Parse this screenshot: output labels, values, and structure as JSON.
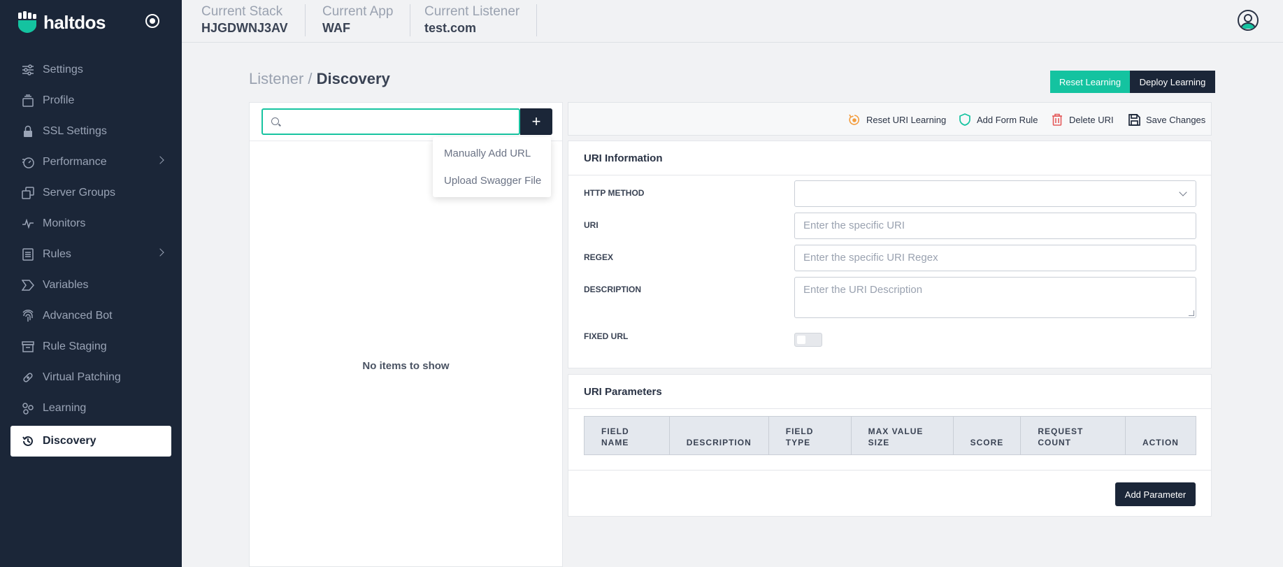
{
  "brand": {
    "name": "haltdos"
  },
  "sidebar": {
    "items": [
      {
        "label": "Settings",
        "icon": "sliders-icon",
        "has_submenu": false
      },
      {
        "label": "Profile",
        "icon": "profile-icon",
        "has_submenu": false
      },
      {
        "label": "SSL Settings",
        "icon": "lock-icon",
        "has_submenu": false
      },
      {
        "label": "Performance",
        "icon": "gauge-icon",
        "has_submenu": true
      },
      {
        "label": "Server Groups",
        "icon": "server-groups-icon",
        "has_submenu": false
      },
      {
        "label": "Monitors",
        "icon": "pulse-icon",
        "has_submenu": false
      },
      {
        "label": "Rules",
        "icon": "list-icon",
        "has_submenu": true
      },
      {
        "label": "Variables",
        "icon": "tag-icon",
        "has_submenu": false
      },
      {
        "label": "Advanced Bot",
        "icon": "fingerprint-icon",
        "has_submenu": false
      },
      {
        "label": "Rule Staging",
        "icon": "archive-icon",
        "has_submenu": false
      },
      {
        "label": "Virtual Patching",
        "icon": "bandage-icon",
        "has_submenu": false
      },
      {
        "label": "Learning",
        "icon": "nodes-icon",
        "has_submenu": false
      },
      {
        "label": "Discovery",
        "icon": "history-icon",
        "has_submenu": false,
        "active": true
      }
    ]
  },
  "topbar": {
    "stack": {
      "label": "Current Stack",
      "value": "HJGDWNJ3AV"
    },
    "app": {
      "label": "Current App",
      "value": "WAF"
    },
    "listener": {
      "label": "Current Listener",
      "value": "test.com"
    }
  },
  "breadcrumb": {
    "parent": "Listener /",
    "current": "Discovery"
  },
  "actions": {
    "reset_learning": "Reset Learning",
    "deploy_learning": "Deploy Learning"
  },
  "left_panel": {
    "search_value": "",
    "add_symbol": "+",
    "empty_text": "No items to show",
    "dropdown": [
      "Manually Add URL",
      "Upload Swagger File"
    ]
  },
  "toolbar": {
    "reset_uri": "Reset URI Learning",
    "add_form_rule": "Add Form Rule",
    "delete_uri": "Delete URI",
    "save_changes": "Save Changes"
  },
  "uri_info": {
    "title": "URI Information",
    "http_method_label": "HTTP METHOD",
    "http_method_value": "",
    "uri_label": "URI",
    "uri_placeholder": "Enter the specific URI",
    "regex_label": "REGEX",
    "regex_placeholder": "Enter the specific URI Regex",
    "description_label": "DESCRIPTION",
    "description_placeholder": "Enter the URI Description",
    "fixed_url_label": "FIXED URL",
    "fixed_url_on": false
  },
  "uri_params": {
    "title": "URI Parameters",
    "columns": [
      "FIELD NAME",
      "DESCRIPTION",
      "FIELD TYPE",
      "MAX VALUE SIZE",
      "SCORE",
      "REQUEST COUNT",
      "ACTION"
    ],
    "add_button": "Add Parameter"
  },
  "colors": {
    "sidebar_bg": "#1b2638",
    "accent": "#14c3a0",
    "danger": "#e45b5b",
    "warning": "#f39c3d"
  }
}
